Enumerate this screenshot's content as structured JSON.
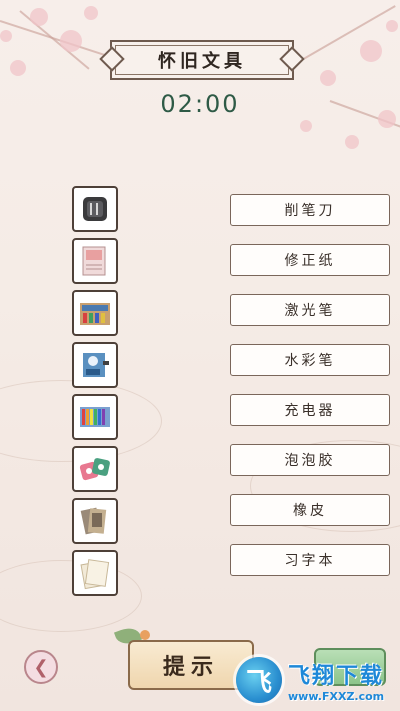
{
  "header": {
    "title": "怀旧文具",
    "timer": "02:00"
  },
  "tiles": [
    {
      "name": "tile-sharpener"
    },
    {
      "name": "tile-correction-paper"
    },
    {
      "name": "tile-laser-pen"
    },
    {
      "name": "tile-watercolor-pens"
    },
    {
      "name": "tile-charger"
    },
    {
      "name": "tile-bubble-gum"
    },
    {
      "name": "tile-eraser"
    },
    {
      "name": "tile-copybook"
    }
  ],
  "words": [
    {
      "label": "削笔刀"
    },
    {
      "label": "修正纸"
    },
    {
      "label": "激光笔"
    },
    {
      "label": "水彩笔"
    },
    {
      "label": "充电器"
    },
    {
      "label": "泡泡胶"
    },
    {
      "label": "橡皮"
    },
    {
      "label": "习字本"
    }
  ],
  "footer": {
    "back_icon": "chevron-left-icon",
    "hint_label": "提示"
  },
  "watermark": {
    "logo_char": "飞",
    "site_name": "飞翔下载",
    "url": "www.FXXZ.com"
  },
  "colors": {
    "timer": "#2e5a46",
    "back_accent": "#b0606a",
    "next_button": "#8cc48a",
    "watermark": "#1e88d8"
  }
}
